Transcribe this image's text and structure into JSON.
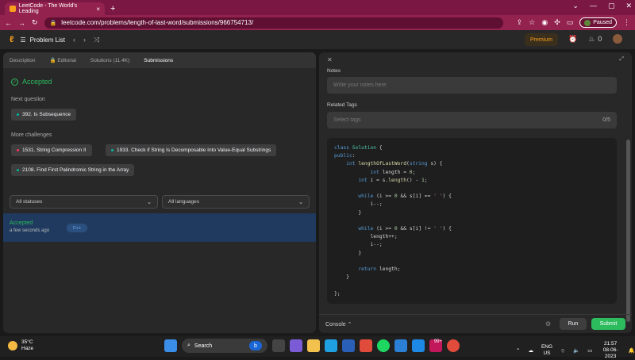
{
  "browser": {
    "tab_title": "LeetCode - The World's Leading",
    "url": "leetcode.com/problems/length-of-last-word/submissions/966754713/",
    "profile_status": "Paused"
  },
  "header": {
    "problem_list": "Problem List",
    "premium": "Premium",
    "streak": "0"
  },
  "left": {
    "tabs": [
      "Description",
      "Editorial",
      "Solutions (11.4K)",
      "Submissions"
    ],
    "status": "Accepted",
    "next_question_heading": "Next question",
    "next_question": "392. Is Subsequence",
    "more_challenges_heading": "More challenges",
    "challenges": [
      "1531. String Compression II",
      "1933. Check if String Is Decomposable Into Value-Equal Substrings",
      "2108. Find First Palindromic String in the Array"
    ],
    "status_filter": "All statuses",
    "language_filter": "All languages",
    "submission": {
      "status": "Accepted",
      "time": "a few seconds ago",
      "language": "C++"
    }
  },
  "right": {
    "notes_label": "Notes",
    "notes_placeholder": "Write your notes here",
    "tags_label": "Related Tags",
    "tags_placeholder": "Select tags",
    "tags_count": "0/5",
    "console": "Console",
    "run": "Run",
    "submit": "Submit"
  },
  "taskbar": {
    "temp": "35°C",
    "condition": "Haze",
    "search": "Search",
    "lang1": "ENG",
    "lang2": "US",
    "time": "21:57",
    "date": "08-06-2023",
    "badge": "99+"
  }
}
